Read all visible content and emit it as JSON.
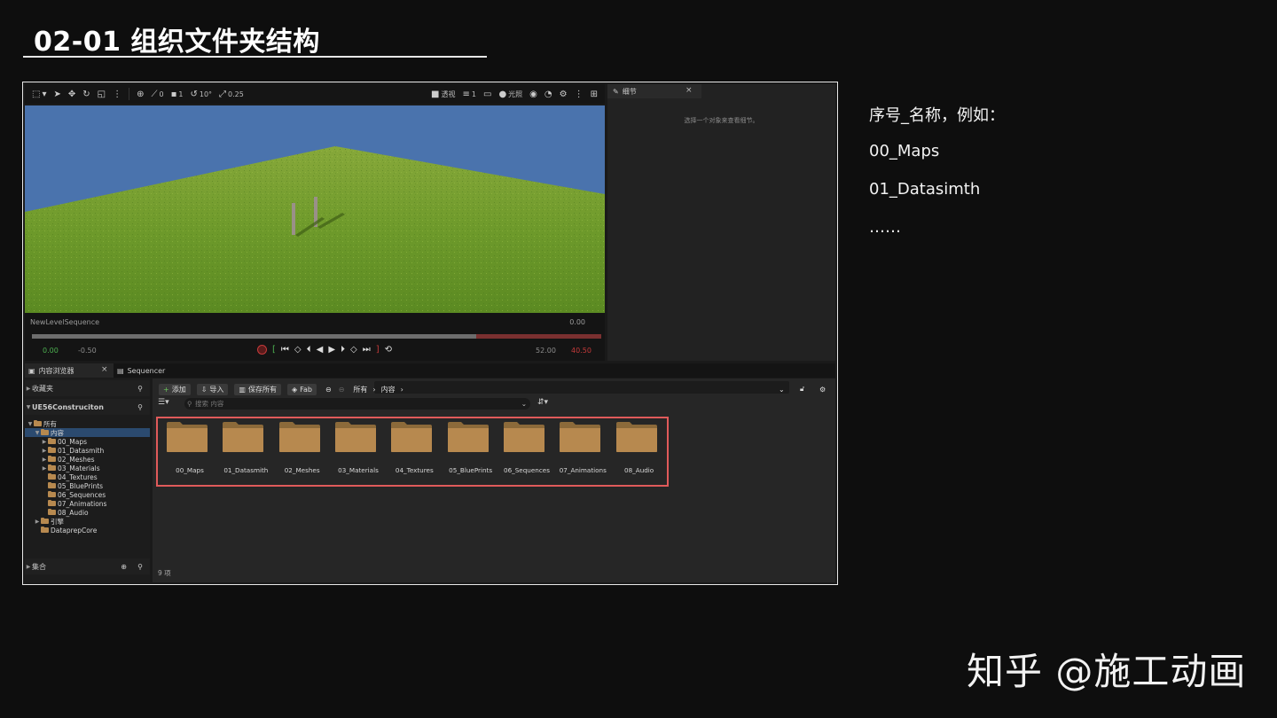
{
  "slide": {
    "title": "02-01 组织文件夹结构",
    "notes": [
      "序号_名称，例如：",
      "00_Maps",
      "01_Datasimth",
      "……"
    ],
    "watermark": "知乎 @施工动画"
  },
  "viewport_toolbar": {
    "snap_angle": "0",
    "grid_value": "1",
    "rotation": "10°",
    "scale": "0.25",
    "perspective_label": "透视",
    "lit_label": "光照",
    "camera_speed": "1"
  },
  "sequencer": {
    "name": "NewLevelSequence",
    "current_time": "0.00",
    "start": "0.00",
    "offset": "-0.50",
    "end": "52.00",
    "end_red": "40.50",
    "progress": 0.78
  },
  "details_panel": {
    "tab_label": "细节",
    "message": "选择一个对象来查看细节。"
  },
  "content_browser": {
    "tab_label": "内容浏览器",
    "sequencer_tab": "Sequencer",
    "favorites_label": "收藏夹",
    "project_name": "UE56Construciton",
    "collections_label": "集合",
    "add_label": "添加",
    "import_label": "导入",
    "save_all_label": "保存所有",
    "fab_label": "Fab",
    "path": [
      "所有",
      "内容"
    ],
    "search_placeholder": "搜索 内容",
    "item_count": "9 项",
    "tree": [
      {
        "label": "所有",
        "level": 0,
        "expanded": true
      },
      {
        "label": "内容",
        "level": 1,
        "expanded": true,
        "selected": true
      },
      {
        "label": "00_Maps",
        "level": 2,
        "has_children": true
      },
      {
        "label": "01_Datasmith",
        "level": 2,
        "has_children": true
      },
      {
        "label": "02_Meshes",
        "level": 2,
        "has_children": true
      },
      {
        "label": "03_Materials",
        "level": 2,
        "has_children": true
      },
      {
        "label": "04_Textures",
        "level": 2
      },
      {
        "label": "05_BluePrints",
        "level": 2
      },
      {
        "label": "06_Sequences",
        "level": 2
      },
      {
        "label": "07_Animations",
        "level": 2
      },
      {
        "label": "08_Audio",
        "level": 2
      },
      {
        "label": "引擎",
        "level": 1,
        "has_children": true
      },
      {
        "label": "DataprepCore",
        "level": 1
      }
    ],
    "folders": [
      "00_Maps",
      "01_Datasmith",
      "02_Meshes",
      "03_Materials",
      "04_Textures",
      "05_BluePrints",
      "06_Sequences",
      "07_Animations",
      "08_Audio"
    ]
  },
  "colors": {
    "highlight": "#e05a5a",
    "folder": "#b7894f",
    "sky": "#4a73ad",
    "grass": "#6f9a2c"
  }
}
